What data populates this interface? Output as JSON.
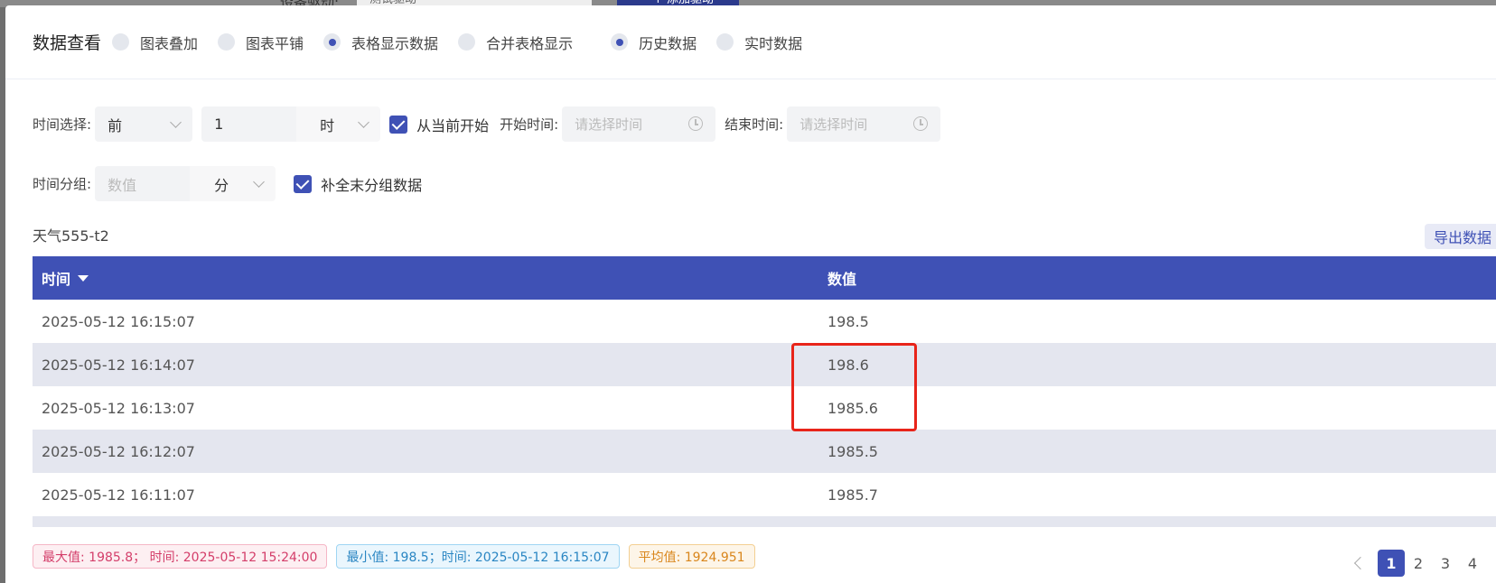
{
  "background": {
    "label": "设备驱动:",
    "select_value": "测试驱动",
    "button_label": "+ 添加驱动"
  },
  "header": {
    "title": "数据查看",
    "view_options": [
      {
        "label": "图表叠加",
        "selected": false
      },
      {
        "label": "图表平铺",
        "selected": false
      },
      {
        "label": "表格显示数据",
        "selected": true
      },
      {
        "label": "合并表格显示",
        "selected": false
      }
    ],
    "data_options": [
      {
        "label": "历史数据",
        "selected": true
      },
      {
        "label": "实时数据",
        "selected": false
      }
    ]
  },
  "filters": {
    "time_label": "时间选择:",
    "direction_value": "前",
    "amount_value": "1",
    "unit_value": "时",
    "from_now_label": "从当前开始",
    "start_label": "开始时间:",
    "start_placeholder": "请选择时间",
    "end_label": "结束时间:",
    "end_placeholder": "请选择时间",
    "group_label": "时间分组:",
    "group_placeholder": "数值",
    "group_unit": "分",
    "fill_label": "补全末分组数据"
  },
  "table": {
    "name": "天气555-t2",
    "export_label": "导出数据",
    "columns": [
      "时间",
      "数值"
    ],
    "rows": [
      {
        "time": "2025-05-12 16:15:07",
        "value": "198.5"
      },
      {
        "time": "2025-05-12 16:14:07",
        "value": "198.6"
      },
      {
        "time": "2025-05-12 16:13:07",
        "value": "1985.6"
      },
      {
        "time": "2025-05-12 16:12:07",
        "value": "1985.5"
      },
      {
        "time": "2025-05-12 16:11:07",
        "value": "1985.7"
      }
    ]
  },
  "stats": {
    "max": "最大值: 1985.8； 时间: 2025-05-12 15:24:00",
    "min": "最小值: 198.5；时间: 2025-05-12 16:15:07",
    "avg": "平均值: 1924.951"
  },
  "pagination": {
    "pages": [
      "1",
      "2",
      "3",
      "4"
    ],
    "current": "1"
  }
}
